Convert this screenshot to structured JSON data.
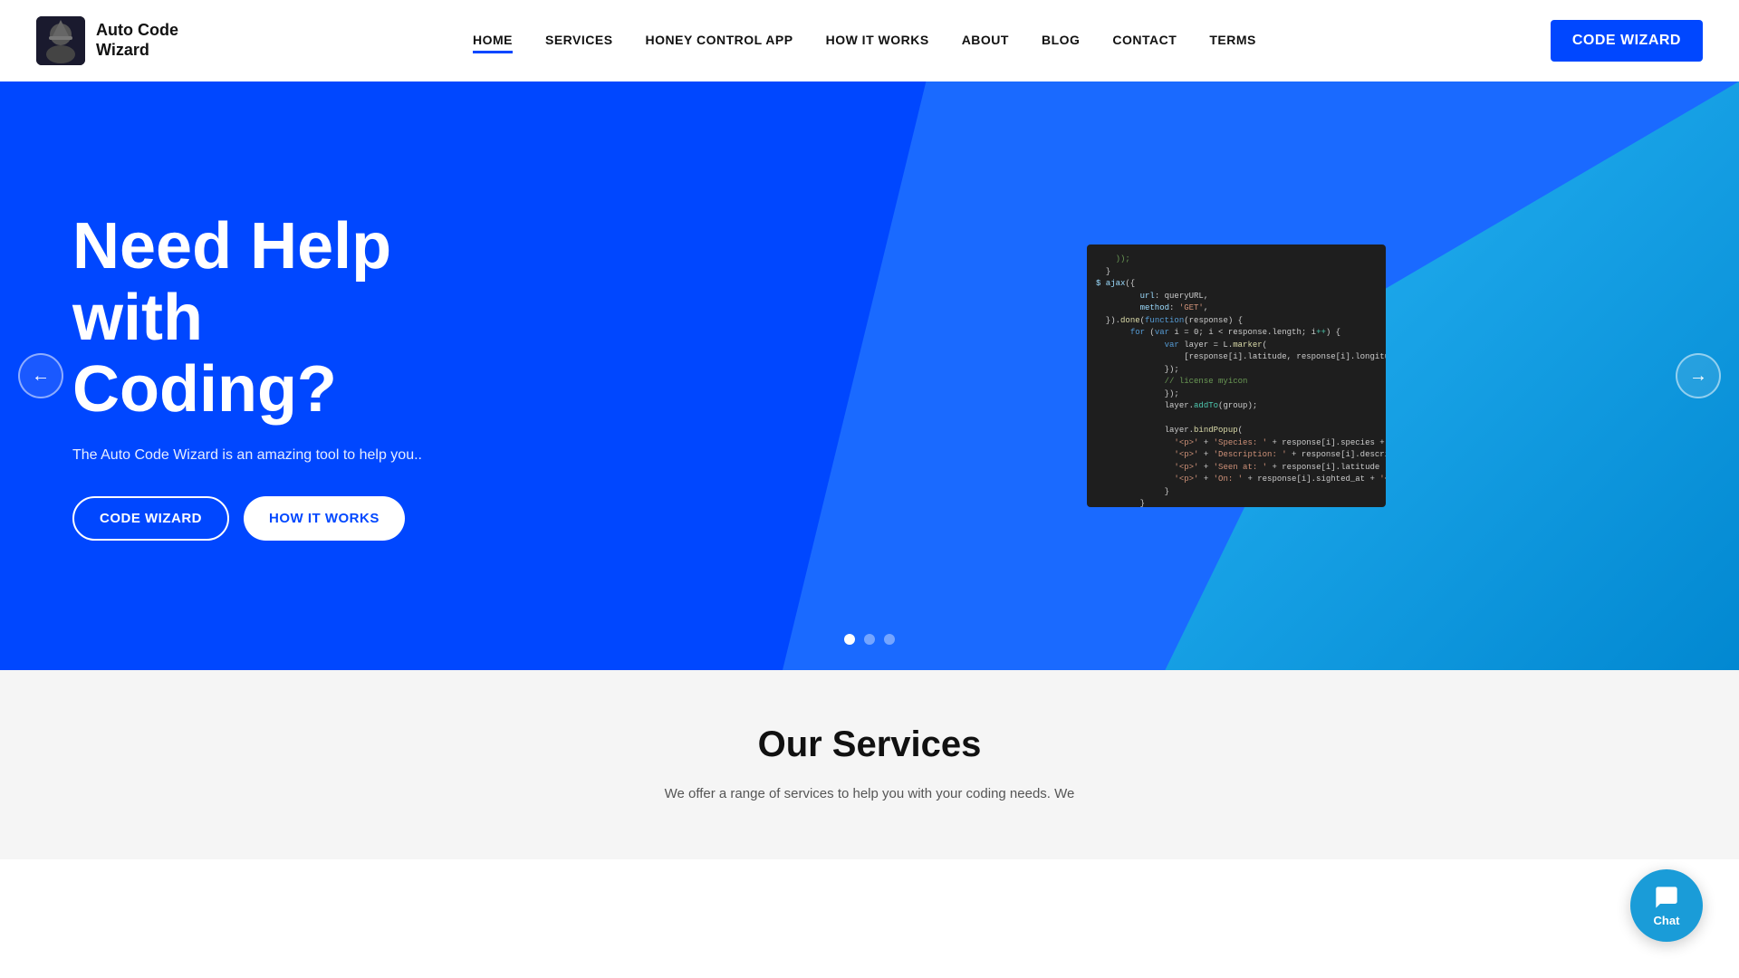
{
  "brand": {
    "name_line1": "Auto Code",
    "name_line2": "Wizard"
  },
  "navbar": {
    "links": [
      {
        "id": "home",
        "label": "HOME",
        "active": true
      },
      {
        "id": "services",
        "label": "SERVICES",
        "active": false
      },
      {
        "id": "honey-control-app",
        "label": "HONEY CONTROL APP",
        "active": false
      },
      {
        "id": "how-it-works",
        "label": "HOW IT WORKS",
        "active": false
      },
      {
        "id": "about",
        "label": "ABOUT",
        "active": false
      },
      {
        "id": "blog",
        "label": "BLOG",
        "active": false
      },
      {
        "id": "contact",
        "label": "CONTACT",
        "active": false
      },
      {
        "id": "terms",
        "label": "TERMS",
        "active": false
      }
    ],
    "cta_label": "CODE WIZARD"
  },
  "hero": {
    "title_line1": "Need Help",
    "title_line2": "with",
    "title_line3": "Coding?",
    "subtitle": "The Auto Code Wizard is an amazing tool to help you..",
    "btn_code_wizard": "CODE WIZARD",
    "btn_how_it_works": "HOW IT WORKS"
  },
  "carousel": {
    "dots_count": 3,
    "active_dot": 0
  },
  "services": {
    "title": "Our Services",
    "subtitle": "We offer a range of services to help you with your coding needs. We"
  },
  "chat": {
    "label": "Chat"
  },
  "code_snippet": "    ));\n  }\n$ ajax({\n         url: queryURL,\n         method: 'GET',\n  }).done(function(response) {\n       for (var i = 0; i < response.length; i++) {\n              var layer = L.marker(\n                  [response[i].latitude, response[i].longitude\n              });\n              // license myicon\n              });\n              layer.addTo(group);\n\n              layer.bindPopup(\n                '<p>' + 'Species: ' + response[i].species +\n                '<p>' + 'Description: ' + response[i].descrip\n                '<p>' + 'Seen at: ' + response[i].latitude +\n                '<p>' + 'On: ' + response[i].sighted_at + '<\n              }\n         }\n         $('select').change(function() {\n              species = this.value;\n         });\n  });\n$ ajax({\n         url: queryURL,\n         method: 'GET',\n  }).done(function(response) {\n       for (var i = 0; i < response.length; i++) {\n              var layer = L.marker(\n                  [response[i].latitude, response[i].longitude"
}
